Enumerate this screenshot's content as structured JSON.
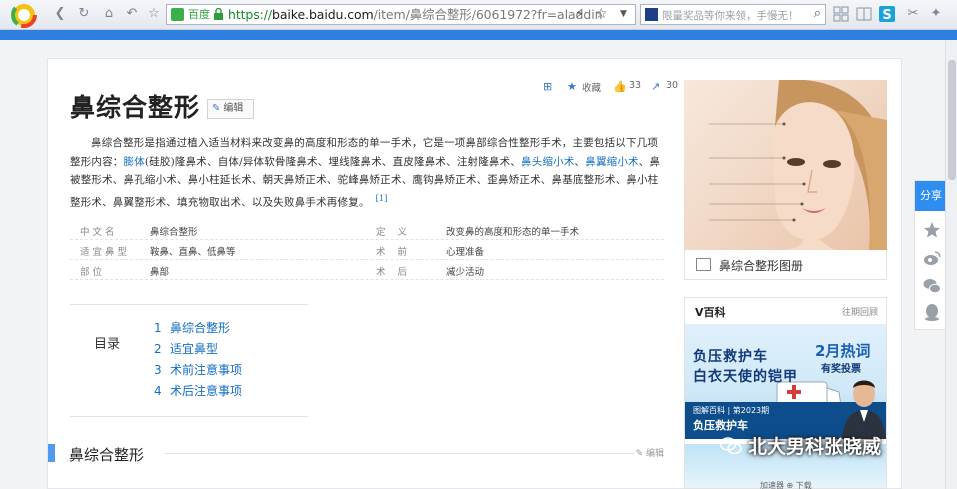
{
  "browser": {
    "address": {
      "site_badge": "百度",
      "url_scheme": "https://",
      "url_host": "baike.baidu.com",
      "url_path": "/item/鼻综合整形/6061972?fr=aladdin"
    },
    "search": {
      "placeholder": "限量奖品等你来领，手慢无！"
    }
  },
  "article": {
    "title": "鼻综合整形",
    "edit_label": "编辑",
    "tools": {
      "favorite": "收藏",
      "likes": "33",
      "shares": "30"
    },
    "summary": {
      "p1": "鼻综合整形是指通过植入适当材料来改变鼻的高度和形态的单一手术，它是一项鼻部综合性整形手术，主要包括以下几项整形内容：",
      "link1": "膨体",
      "p2": "(硅胶)隆鼻术、自体/异体软骨隆鼻术、埋线隆鼻术、直皮隆鼻术、注射隆鼻术、",
      "link2": "鼻头缩小术",
      "p3": "、",
      "link3": "鼻翼缩小术",
      "p4": "、鼻被整形术、鼻孔缩小术、鼻小柱延长术、朝天鼻矫正术、驼峰鼻矫正术、鹰钩鼻矫正术、歪鼻矫正术、鼻基底整形术、鼻小柱整形术、鼻翼整形术、填充物取出术、以及失败鼻手术再修复。",
      "ref": "[1]"
    },
    "basic_info": [
      {
        "n1": "中文名",
        "v1": "鼻综合整形",
        "n2": "定义",
        "v2": "改变鼻的高度和形态的单一手术"
      },
      {
        "n1": "适宜鼻型",
        "v1": "鞍鼻、直鼻、低鼻等",
        "n2": "术前",
        "v2": "心理准备"
      },
      {
        "n1": "部位",
        "v1": "鼻部",
        "n2": "术后",
        "v2": "减少活动"
      }
    ],
    "toc": {
      "label": "目录",
      "items": [
        {
          "num": "1",
          "text": "鼻综合整形"
        },
        {
          "num": "2",
          "text": "适宜鼻型"
        },
        {
          "num": "3",
          "text": "术前注意事项"
        },
        {
          "num": "4",
          "text": "术后注意事项"
        }
      ]
    },
    "section": {
      "heading": "鼻综合整形",
      "edit": "编辑"
    }
  },
  "sidebar": {
    "album_label": "鼻综合整形图册",
    "vbaike": {
      "title": "V百科",
      "more": "往期回顾",
      "banner_line1": "负压救护车",
      "banner_line2": "白衣天使的铠甲",
      "banner_issue": "图解百科 | 第2023期",
      "banner_caption": "负压救护车",
      "hot_title": "2月热词",
      "hot_sub": "有奖投票"
    },
    "share": {
      "label": "分享"
    }
  },
  "watermark": "北大男科张晓威",
  "status_text": "加速器   ⊕ 下载",
  "colors": {
    "accent": "#2d7fe0",
    "link": "#136ec2",
    "section_bar": "#4f9cee"
  }
}
